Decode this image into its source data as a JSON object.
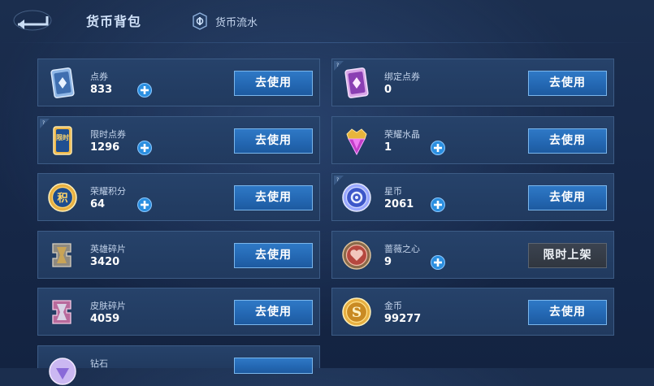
{
  "header": {
    "title": "货币背包",
    "flow_label": "货币流水"
  },
  "currencies": [
    {
      "name": "点券",
      "value": "833",
      "action": "去使用",
      "icon": "ticket-card-icon"
    },
    {
      "name": "绑定点券",
      "value": "0",
      "action": "去使用",
      "icon": "bound-ticket-card-icon"
    },
    {
      "name": "限时点券",
      "value": "1296",
      "action": "去使用",
      "icon": "limited-ticket-card-icon",
      "icon_text": "限时"
    },
    {
      "name": "荣耀水晶",
      "value": "1",
      "action": "去使用",
      "icon": "glory-crystal-icon"
    },
    {
      "name": "荣耀积分",
      "value": "64",
      "action": "去使用",
      "icon": "glory-points-coin-icon",
      "icon_text": "积"
    },
    {
      "name": "星币",
      "value": "2061",
      "action": "去使用",
      "icon": "star-coin-icon"
    },
    {
      "name": "英雄碎片",
      "value": "3420",
      "action": "去使用",
      "icon": "hero-fragment-icon"
    },
    {
      "name": "蔷薇之心",
      "value": "9",
      "action": "限时上架",
      "icon": "rose-heart-icon"
    },
    {
      "name": "皮肤碎片",
      "value": "4059",
      "action": "去使用",
      "icon": "skin-fragment-icon"
    },
    {
      "name": "金币",
      "value": "99277",
      "action": "去使用",
      "icon": "gold-coin-icon",
      "icon_text": "S"
    },
    {
      "name": "钻石",
      "value": "",
      "action": "",
      "icon": "diamond-icon"
    }
  ],
  "colors": {
    "card_bg": "#233d63",
    "card_border": "#3d5c86",
    "use_button": "#2a70bd",
    "limited_button": "#353c46",
    "plus_button": "#2b8fe0"
  }
}
